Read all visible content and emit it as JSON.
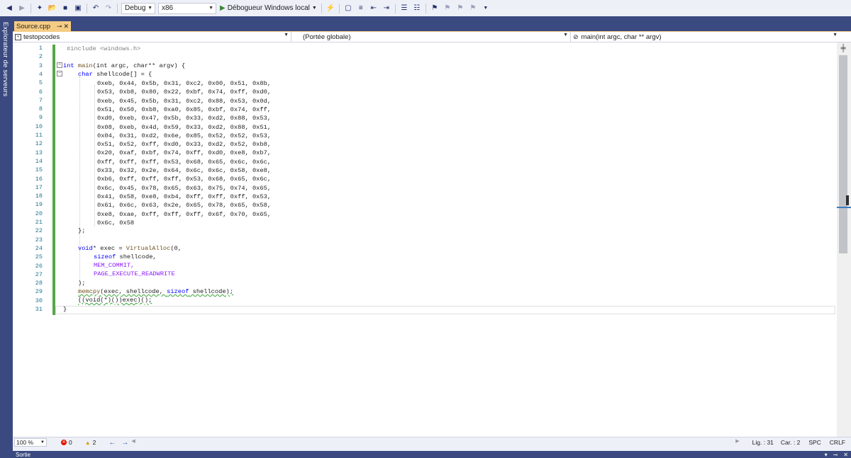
{
  "toolbar": {
    "configuration": "Debug",
    "platform": "x86",
    "run_label": "Débogueur Windows local"
  },
  "sidebar": {
    "server_explorer_label": "Explorateur de serveurs"
  },
  "tabs": [
    {
      "label": "Source.cpp"
    }
  ],
  "navbar": {
    "project": "testopcodes",
    "scope": "(Portée globale)",
    "member": "main(int argc, char ** argv)"
  },
  "editor": {
    "line_numbers": [
      "1",
      "2",
      "3",
      "4",
      "5",
      "6",
      "7",
      "8",
      "9",
      "10",
      "11",
      "12",
      "13",
      "14",
      "15",
      "16",
      "17",
      "18",
      "19",
      "20",
      "21",
      "22",
      "23",
      "24",
      "25",
      "26",
      "27",
      "28",
      "29",
      "30",
      "31"
    ],
    "shellcode_rows": [
      "0xeb, 0x44, 0x5b, 0x31, 0xc2, 0x00, 0x51, 0x8b,",
      "0x53, 0xb8, 0x80, 0x22, 0xbf, 0x74, 0xff, 0xd0,",
      "0xeb, 0x45, 0x5b, 0x31, 0xc2, 0x88, 0x53, 0x0d,",
      "0x51, 0x50, 0xb8, 0xa0, 0x85, 0xbf, 0x74, 0xff,",
      "0xd0, 0xeb, 0x47, 0x5b, 0x33, 0xd2, 0x88, 0x53,",
      "0x08, 0xeb, 0x4d, 0x59, 0x33, 0xd2, 0x88, 0x51,",
      "0x04, 0x31, 0xd2, 0x6e, 0x85, 0x52, 0x52, 0x53,",
      "0x51, 0x52, 0xff, 0xd0, 0x33, 0xd2, 0x52, 0xb8,",
      "0x20, 0xaf, 0xbf, 0x74, 0xff, 0xd0, 0xe8, 0xb7,",
      "0xff, 0xff, 0xff, 0x53, 0x68, 0x65, 0x6c, 0x6c,",
      "0x33, 0x32, 0x2e, 0x64, 0x6c, 0x6c, 0x58, 0xe8,",
      "0xb6, 0xff, 0xff, 0xff, 0x53, 0x68, 0x65, 0x6c,",
      "0x6c, 0x45, 0x78, 0x65, 0x63, 0x75, 0x74, 0x65,",
      "0x41, 0x58, 0xe8, 0xb4, 0xff, 0xff, 0xff, 0x53,",
      "0x61, 0x6c, 0x63, 0x2e, 0x65, 0x78, 0x65, 0x58,",
      "0xe8, 0xae, 0xff, 0xff, 0xff, 0x6f, 0x70, 0x65,",
      "0x6c, 0x58"
    ],
    "line1": "#include <windows.h>",
    "main_sig_pre": "int",
    "main_sig_fn": "main",
    "main_sig_rest": "(int argc, char** argv) {",
    "char_decl_kw": "char",
    "char_decl_rest": " shellcode[] = {",
    "close_array": "};",
    "line24_kw": "void",
    "line24_rest": "* exec = ",
    "line24_fn": "VirtualAlloc",
    "line24_args": "(0,",
    "line25_kw": "sizeof",
    "line25_rest": " shellcode,",
    "line26": "MEM_COMMIT,",
    "line27": "PAGE_EXECUTE_READWRITE",
    "line28": ");",
    "line29_fn": "memcpy",
    "line29_args": "(exec, shellcode, ",
    "line29_kw": "sizeof",
    "line29_end": " shellcode);",
    "line30": "((void(*)())exec)();",
    "line31": "}"
  },
  "status": {
    "zoom": "100 %",
    "errors": "0",
    "warnings": "2",
    "line": "Lig. : 31",
    "col": "Car. : 2",
    "spc": "SPC",
    "crlf": "CRLF"
  },
  "output": {
    "label": "Sortie"
  },
  "colors": {
    "accent": "#3a4a80",
    "tab_active": "#f5cc84",
    "changed_bar": "#57a64a",
    "keyword": "#0000ff",
    "macro": "#8a1bff"
  }
}
